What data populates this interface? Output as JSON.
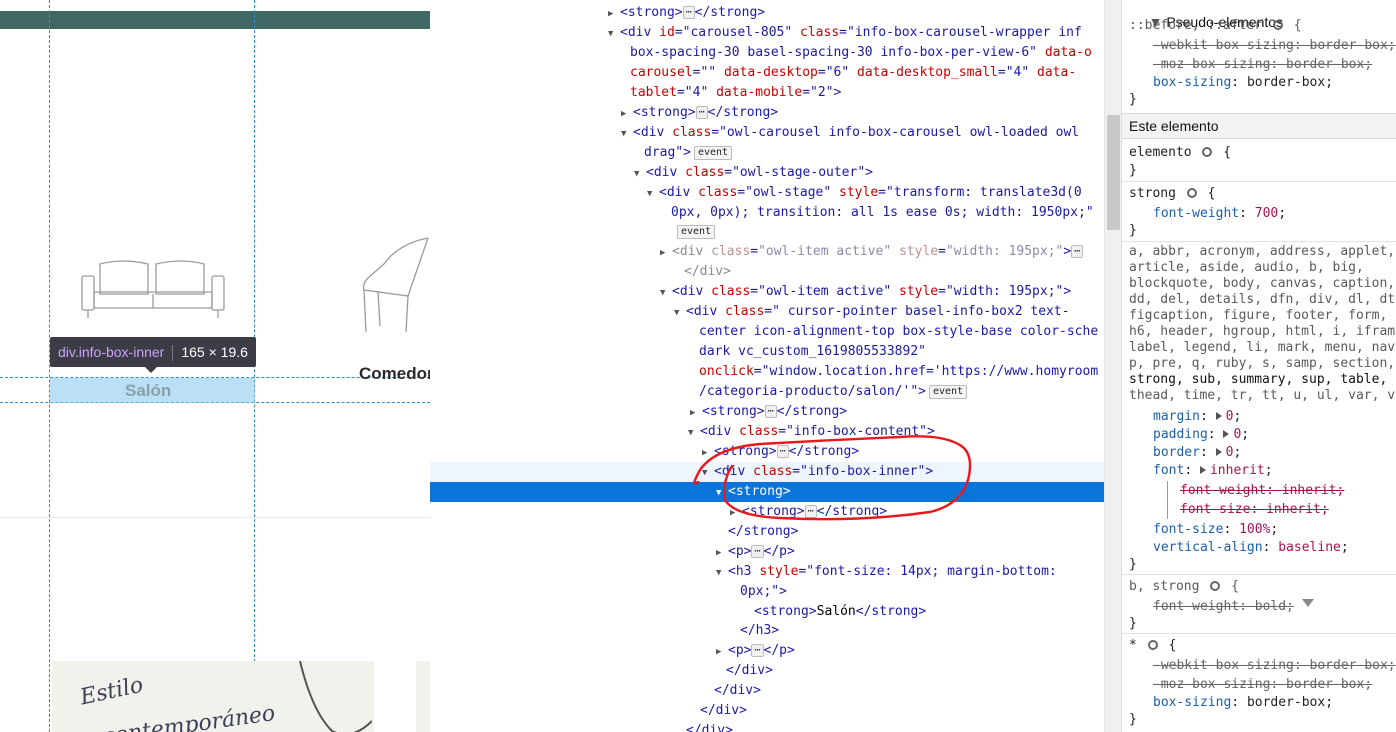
{
  "page": {
    "tooltip_selector": "div.info-box-inner",
    "tooltip_size": "165 × 19.6",
    "category_1": "Salón",
    "category_2": "Comedor",
    "promo_script_1": "Estilo",
    "promo_script_2": "contemporáneo"
  },
  "inspector": {
    "lines": [
      {
        "indent": 190,
        "twisty": "▶",
        "html": "<span class=\"tag\">&lt;strong&gt;</span><span class=\"ellipsis\">⋯</span><span class=\"tag\">&lt;/strong&gt;</span>"
      },
      {
        "indent": 190,
        "twisty": "▼",
        "html": "<span class=\"tag\">&lt;div</span> <span class=\"attr\">id</span>=<span class=\"val\">\"carousel-805\"</span> <span class=\"attr\">class</span>=<span class=\"val\">\"info-box-carousel-wrapper inf</span>"
      },
      {
        "indent": 200,
        "twisty": "",
        "html": "<span class=\"val\">box-spacing-30 basel-spacing-30 info-box-per-view-6\"</span> <span class=\"attr\">data-o</span>"
      },
      {
        "indent": 200,
        "twisty": "",
        "html": "<span class=\"attr\">carousel</span>=<span class=\"val\">\"\"</span> <span class=\"attr\">data-desktop</span>=<span class=\"val\">\"6\"</span> <span class=\"attr\">data-desktop_small</span>=<span class=\"val\">\"4\"</span> <span class=\"attr\">data-</span>"
      },
      {
        "indent": 200,
        "twisty": "",
        "html": "<span class=\"attr\">tablet</span>=<span class=\"val\">\"4\"</span> <span class=\"attr\">data-mobile</span>=<span class=\"val\">\"2\"</span><span class=\"tag\">&gt;</span>"
      },
      {
        "indent": 203,
        "twisty": "▶",
        "html": "<span class=\"tag\">&lt;strong&gt;</span><span class=\"ellipsis\">⋯</span><span class=\"tag\">&lt;/strong&gt;</span>"
      },
      {
        "indent": 203,
        "twisty": "▼",
        "html": "<span class=\"tag\">&lt;div</span> <span class=\"attr\">class</span>=<span class=\"val\">\"owl-carousel info-box-carousel owl-loaded owl</span>"
      },
      {
        "indent": 214,
        "twisty": "",
        "html": "<span class=\"val\">drag\"</span><span class=\"tag\">&gt;</span><span class=\"badge\">event</span>"
      },
      {
        "indent": 216,
        "twisty": "▼",
        "html": "<span class=\"tag\">&lt;div</span> <span class=\"attr\">class</span>=<span class=\"val\">\"owl-stage-outer\"</span><span class=\"tag\">&gt;</span>"
      },
      {
        "indent": 229,
        "twisty": "▼",
        "html": "<span class=\"tag\">&lt;div</span> <span class=\"attr\">class</span>=<span class=\"val\">\"owl-stage\"</span> <span class=\"attr\">style</span>=<span class=\"val\">\"transform: translate3d(0</span>"
      },
      {
        "indent": 241,
        "twisty": "",
        "html": "<span class=\"val\">0px, 0px); transition: all 1s ease 0s; width: 1950px;\"</span>"
      },
      {
        "indent": 244,
        "twisty": "",
        "html": "<span class=\"badge\">event</span>"
      },
      {
        "indent": 242,
        "twisty": "▶",
        "html": "<span class=\"tag\" style=\"color:#8a8a9a\">&lt;div</span> <span class=\"attr\" style=\"color:#c09090\">class</span>=<span class=\"val\" style=\"color:#8a8aaa\">\"owl-item active\"</span> <span class=\"attr\" style=\"color:#c09090\">style</span>=<span class=\"val\" style=\"color:#8a8aaa\">\"width: 195px;\"</span><span class=\"tag\">&gt;</span><span class=\"ellipsis\">⋯</span>"
      },
      {
        "indent": 254,
        "twisty": "",
        "html": "<span class=\"tag\" style=\"color:#8a8a9a\">&lt;/div&gt;</span>"
      },
      {
        "indent": 242,
        "twisty": "▼",
        "html": "<span class=\"tag\">&lt;div</span> <span class=\"attr\">class</span>=<span class=\"val\">\"owl-item active\"</span> <span class=\"attr\">style</span>=<span class=\"val\">\"width: 195px;\"</span><span class=\"tag\">&gt;</span>"
      },
      {
        "indent": 256,
        "twisty": "▼",
        "html": "<span class=\"tag\">&lt;div</span> <span class=\"attr\">class</span>=<span class=\"val\">\" cursor-pointer basel-info-box2 text-</span>"
      },
      {
        "indent": 269,
        "twisty": "",
        "html": "<span class=\"val\">center icon-alignment-top box-style-base color-sche</span>"
      },
      {
        "indent": 269,
        "twisty": "",
        "html": "<span class=\"val\">dark vc_custom_1619805533892\"</span>"
      },
      {
        "indent": 269,
        "twisty": "",
        "html": "<span class=\"attr\">onclick</span>=<span class=\"val\">\"window.location.href='https://www.homyroom</span>"
      },
      {
        "indent": 269,
        "twisty": "",
        "html": "<span class=\"val\">/categoria-producto/salon/'\"</span><span class=\"tag\">&gt;</span><span class=\"badge\">event</span>"
      },
      {
        "indent": 272,
        "twisty": "▶",
        "html": "<span class=\"tag\">&lt;strong&gt;</span><span class=\"ellipsis\">⋯</span><span class=\"tag\">&lt;/strong&gt;</span>"
      },
      {
        "indent": 270,
        "twisty": "▼",
        "html": "<span class=\"tag\">&lt;div</span> <span class=\"attr\">class</span>=<span class=\"val\">\"info-box-content\"</span><span class=\"tag\">&gt;</span>"
      },
      {
        "indent": 284,
        "twisty": "▶",
        "html": "<span class=\"tag\">&lt;strong&gt;</span><span class=\"ellipsis\">⋯</span><span class=\"tag\">&lt;/strong&gt;</span>"
      },
      {
        "indent": 284,
        "twisty": "▼",
        "html": "<span class=\"tag\">&lt;div</span> <span class=\"attr\">class</span>=<span class=\"val\">\"info-box-inner\"</span><span class=\"tag\">&gt;</span>"
      },
      {
        "indent": 298,
        "twisty": "▼",
        "html": "<span class=\"tag\">&lt;strong&gt;</span>"
      },
      {
        "indent": 312,
        "twisty": "▶",
        "html": "<span class=\"tag\">&lt;strong&gt;</span><span class=\"ellipsis\">⋯</span><span class=\"tag\">&lt;/strong&gt;</span>"
      },
      {
        "indent": 298,
        "twisty": "",
        "html": "<span class=\"tag\">&lt;/strong&gt;</span>"
      },
      {
        "indent": 298,
        "twisty": "▶",
        "html": "<span class=\"tag\">&lt;p&gt;</span><span class=\"ellipsis\">⋯</span><span class=\"tag\">&lt;/p&gt;</span>"
      },
      {
        "indent": 298,
        "twisty": "▼",
        "html": "<span class=\"tag\">&lt;h3</span> <span class=\"attr\">style</span>=<span class=\"val\">\"font-size: 14px; margin-bottom:</span>"
      },
      {
        "indent": 310,
        "twisty": "",
        "html": "<span class=\"val\">0px;\"</span><span class=\"tag\">&gt;</span>"
      },
      {
        "indent": 324,
        "twisty": "",
        "html": "<span class=\"tag\">&lt;strong&gt;</span><span class=\"txt\">Salón</span><span class=\"tag\">&lt;/strong&gt;</span>"
      },
      {
        "indent": 310,
        "twisty": "",
        "html": "<span class=\"tag\">&lt;/h3&gt;</span>"
      },
      {
        "indent": 298,
        "twisty": "▶",
        "html": "<span class=\"tag\">&lt;p&gt;</span><span class=\"ellipsis\">⋯</span><span class=\"tag\">&lt;/p&gt;</span>"
      },
      {
        "indent": 296,
        "twisty": "",
        "html": "<span class=\"tag\">&lt;/div&gt;</span>"
      },
      {
        "indent": 284,
        "twisty": "",
        "html": "<span class=\"tag\">&lt;/div&gt;</span>"
      },
      {
        "indent": 270,
        "twisty": "",
        "html": "<span class=\"tag\">&lt;/div&gt;</span>"
      },
      {
        "indent": 256,
        "twisty": "",
        "html": "<span class=\"tag\">&lt;/div&gt;</span>"
      },
      {
        "indent": 242,
        "twisty": "▼",
        "html": "<span class=\"tag\">&lt;div</span> <span class=\"attr\">class</span>=<span class=\"val\">\"owl-item active\"</span> <span class=\"attr\">style</span>=<span class=\"val\">\"width: 195px;\"</span><span class=\"tag\">&gt;</span><span class=\"ellipsis\">⋯</span>"
      }
    ]
  },
  "styles": {
    "pseudo_header": "Pseudo-elementos",
    "pseudo_selector": "::before, ::after",
    "pseudo_decl_1": "-webkit-box-sizing: border-box;",
    "pseudo_decl_2": "-moz-box-sizing: border-box;",
    "pseudo_decl_3_prop": "box-sizing",
    "pseudo_decl_3_val": "border-box",
    "este_elemento": "Este elemento",
    "elemento_selector": "elemento",
    "strong_selector": "strong",
    "fw_prop": "font-weight",
    "fw_val": "700",
    "reset_selector_1": "a, abbr, acronym, address, applet,",
    "reset_selector_2": "article, aside, audio, b, big,",
    "reset_selector_3": "blockquote, body, canvas, caption,",
    "reset_selector_4": "dd, del, details, dfn, div, dl, dt",
    "reset_selector_5": "figcaption, figure, footer, form,",
    "reset_selector_6": "h6, header, hgroup, html, i, ifram",
    "reset_selector_7": "label, legend, li, mark, menu, nav",
    "reset_selector_8": "p, pre, q, ruby, s, samp, section,",
    "reset_selector_9": "strong, sub, summary, sup, table,",
    "reset_selector_10": "thead, time, tr, tt, u, ul, var, v",
    "margin_prop": "margin",
    "margin_val": "0",
    "padding_prop": "padding",
    "padding_val": "0",
    "border_prop": "border",
    "border_val": "0",
    "font_prop": "font",
    "font_val": "inherit",
    "font_sub_1": "font-weight: inherit;",
    "font_sub_2": "font-size: inherit;",
    "fs_prop": "font-size",
    "fs_val": "100%",
    "va_prop": "vertical-align",
    "va_val": "baseline",
    "bstrong_selector": "b, strong",
    "bstrong_decl": "font-weight: bold;",
    "star_selector": "*",
    "star_decl_1": "-webkit-box-sizing: border-box;",
    "star_decl_2": "-moz-box-sizing: border-box;",
    "star_decl_3_prop": "box-sizing",
    "star_decl_3_val": "border-box",
    "open_brace": "{",
    "close_brace": "}"
  }
}
